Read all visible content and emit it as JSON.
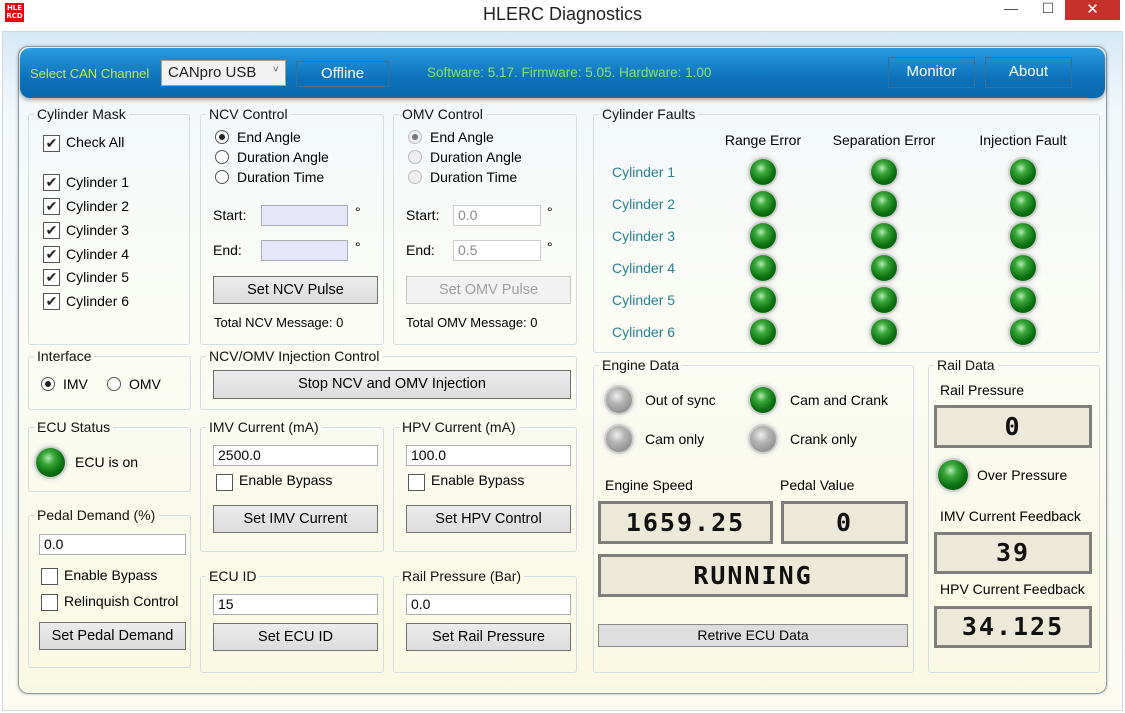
{
  "window": {
    "title": "HLERC Diagnostics",
    "icon_text": "HLE RCD",
    "minimize": "—",
    "maximize": "☐",
    "close": "✕"
  },
  "header": {
    "can_label": "Select CAN Channel",
    "can_channel": "CANpro USB",
    "connect_button": "Offline",
    "versions": "Software: 5.17. Firmware: 5.05. Hardware: 1.00",
    "monitor_button": "Monitor",
    "about_button": "About"
  },
  "cylinder_mask": {
    "title": "Cylinder Mask",
    "check_all": "Check All",
    "items": [
      "Cylinder 1",
      "Cylinder 2",
      "Cylinder 3",
      "Cylinder 4",
      "Cylinder 5",
      "Cylinder 6"
    ],
    "checked": [
      true,
      true,
      true,
      true,
      true,
      true,
      true
    ]
  },
  "ncv": {
    "title": "NCV Control",
    "options": [
      "End Angle",
      "Duration Angle",
      "Duration Time"
    ],
    "selected": "End Angle",
    "start_label": "Start:",
    "end_label": "End:",
    "start": "",
    "end": "",
    "unit": "°",
    "button": "Set NCV Pulse",
    "total": "Total NCV Message: 0"
  },
  "omv": {
    "title": "OMV Control",
    "options": [
      "End Angle",
      "Duration Angle",
      "Duration Time"
    ],
    "selected": "End Angle",
    "start_label": "Start:",
    "end_label": "End:",
    "start": "0.0",
    "end": "0.5",
    "unit": "°",
    "button": "Set OMV Pulse",
    "total": "Total OMV Message: 0"
  },
  "faults": {
    "title": "Cylinder Faults",
    "columns": [
      "Range Error",
      "Separation Error",
      "Injection Fault"
    ],
    "rows": [
      "Cylinder 1",
      "Cylinder 2",
      "Cylinder 3",
      "Cylinder 4",
      "Cylinder 5",
      "Cylinder 6"
    ],
    "led_color": "#0b7010"
  },
  "interface": {
    "title": "Interface",
    "options": [
      "IMV",
      "OMV"
    ],
    "selected": "IMV"
  },
  "injection": {
    "title": "NCV/OMV Injection Control",
    "button": "Stop NCV and OMV Injection"
  },
  "ecu_status": {
    "title": "ECU Status",
    "text": "ECU is on"
  },
  "imv": {
    "title": "IMV Current (mA)",
    "value": "2500.0",
    "bypass": "Enable Bypass",
    "button": "Set IMV Current"
  },
  "hpv": {
    "title": "HPV Current (mA)",
    "value": "100.0",
    "bypass": "Enable Bypass",
    "button": "Set HPV Control"
  },
  "pedal": {
    "title": "Pedal Demand (%)",
    "value": "0.0",
    "bypass": "Enable Bypass",
    "relinquish": "Relinquish Control",
    "button": "Set Pedal Demand"
  },
  "ecu_id": {
    "title": "ECU ID",
    "value": "15",
    "button": "Set ECU ID"
  },
  "rail_set": {
    "title": "Rail Pressure (Bar)",
    "value": "0.0",
    "button": "Set Rail Pressure"
  },
  "engine": {
    "title": "Engine Data",
    "out_of_sync": "Out of sync",
    "cam_and_crank": "Cam and Crank",
    "cam_only": "Cam only",
    "crank_only": "Crank only",
    "speed_label": "Engine Speed",
    "pedal_label": "Pedal Value",
    "speed": "1659.25",
    "pedal": "0",
    "state": "RUNNING",
    "button": "Retrive ECU Data"
  },
  "rail": {
    "title": "Rail Data",
    "pressure_label": "Rail Pressure",
    "pressure": "0",
    "over_pressure": "Over Pressure",
    "imv_label": "IMV Current Feedback",
    "imv": "39",
    "hpv_label": "HPV Current Feedback",
    "hpv": "34.125"
  }
}
